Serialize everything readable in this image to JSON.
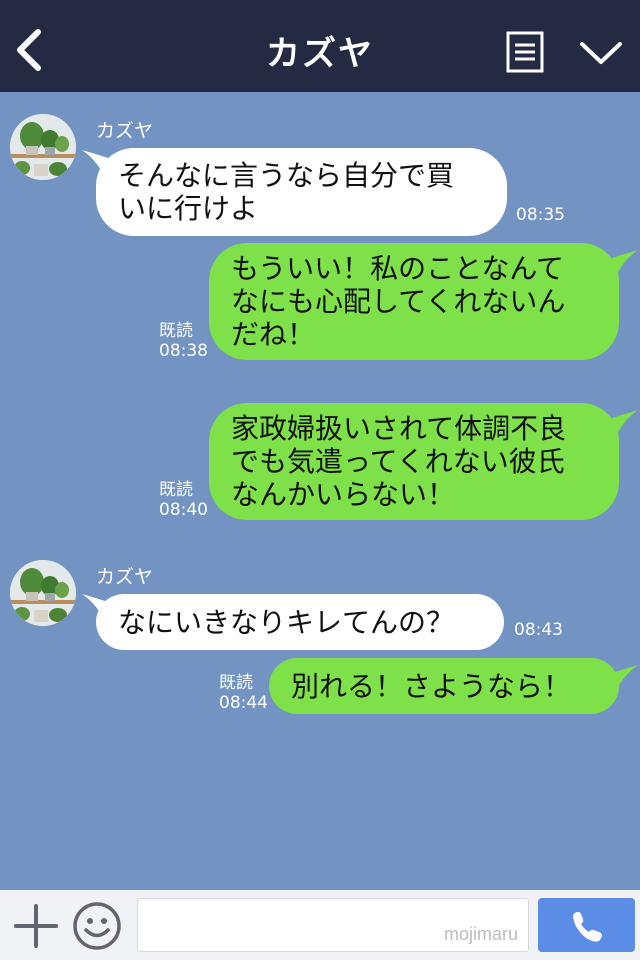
{
  "header": {
    "title": "カズヤ",
    "back_icon": "chevron-left-icon",
    "menu_icon": "notes-icon",
    "down_icon": "chevron-down-icon",
    "bg_color": "#232a42"
  },
  "chat": {
    "bg_color": "#7393c3",
    "messages": [
      {
        "direction": "in",
        "sender": "カズヤ",
        "text": "そんなに言うなら自分で買\nいに行けよ",
        "time": "08:35"
      },
      {
        "direction": "out",
        "read": "既読",
        "text": "もういい！私のことなんて\nなにも心配してくれないん\nだね！",
        "time": "08:38"
      },
      {
        "direction": "out",
        "read": "既読",
        "text": "家政婦扱いされて体調不良\nでも気遣ってくれない彼氏\nなんかいらない！",
        "time": "08:40"
      },
      {
        "direction": "in",
        "sender": "カズヤ",
        "text": "なにいきなりキレてんの？",
        "time": "08:43"
      },
      {
        "direction": "out",
        "read": "既読",
        "text": "別れる！さようなら！",
        "time": "08:44"
      }
    ],
    "bubble_colors": {
      "incoming": "#ffffff",
      "outgoing": "#7fe14a"
    }
  },
  "bottom": {
    "plus_icon": "plus-icon",
    "emoji_icon": "smiley-icon",
    "input_value": "",
    "watermark": "mojimaru",
    "call_icon": "phone-icon",
    "call_color": "#5b8de6"
  }
}
